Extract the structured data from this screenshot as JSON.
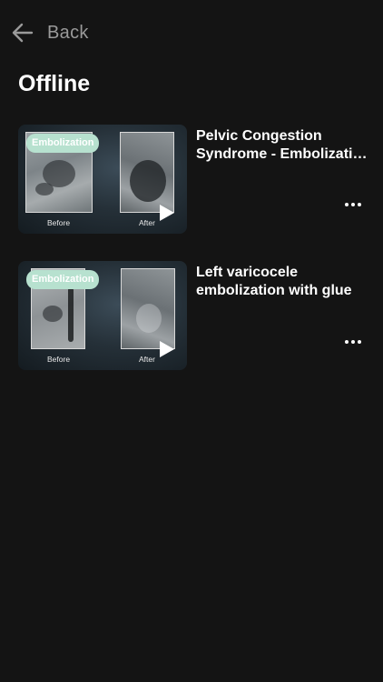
{
  "header": {
    "back_label": "Back",
    "back_icon": "arrow-left-icon"
  },
  "page": {
    "title": "Offline"
  },
  "videos": [
    {
      "badge": "Embolization",
      "before_caption": "Before",
      "after_caption": "After",
      "title_line1": "Pelvic Congestion",
      "title_line2": "Syndrome - Embolization",
      "play_icon": "play-icon",
      "more_icon": "more-horizontal-icon"
    },
    {
      "badge": "Embolization",
      "before_caption": "Before",
      "after_caption": "After",
      "title_line1": "Left varicocele",
      "title_line2": "embolization with glue",
      "play_icon": "play-icon",
      "more_icon": "more-horizontal-icon"
    }
  ],
  "colors": {
    "background": "#141414",
    "badge": "#b7e1cf",
    "back_text": "#9a9a9a"
  }
}
